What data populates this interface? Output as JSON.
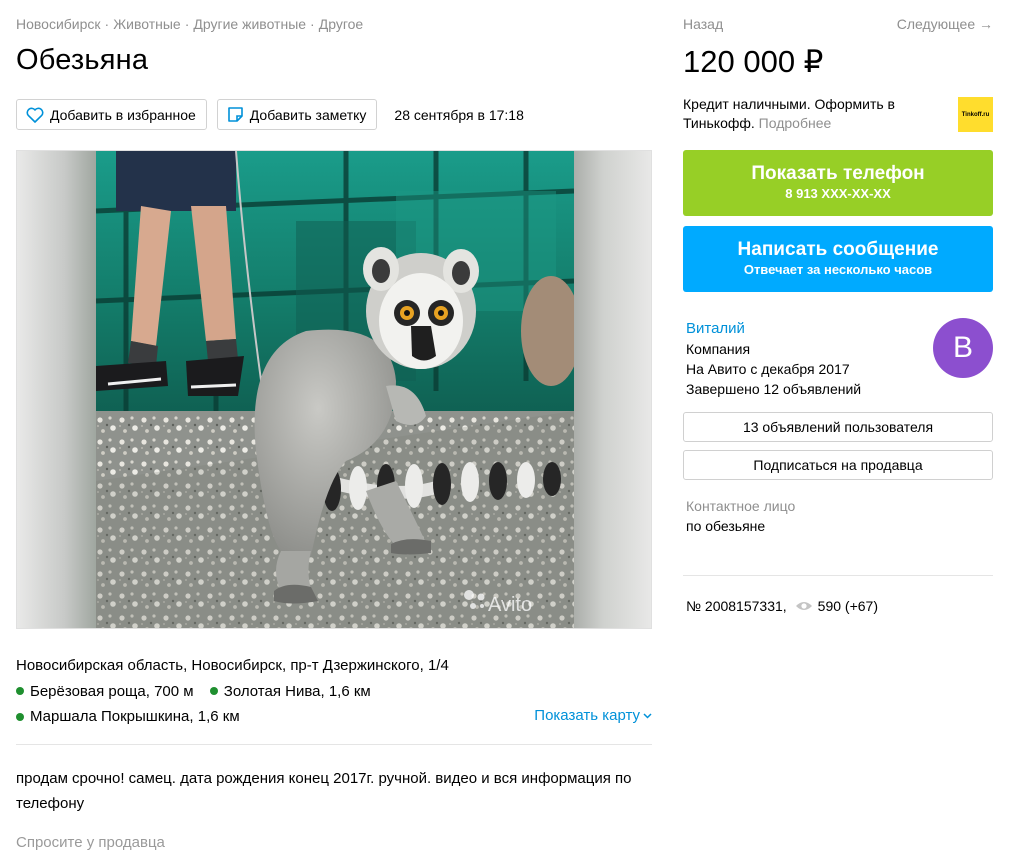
{
  "breadcrumbs": [
    "Новосибирск",
    "Животные",
    "Другие животные",
    "Другое"
  ],
  "breadcrumb_sep": "·",
  "title": "Обезьяна",
  "actions": {
    "favorite_label": "Добавить в избранное",
    "note_label": "Добавить заметку",
    "date": "28 сентября в 17:18"
  },
  "gallery": {
    "watermark": "Avito"
  },
  "location": {
    "address": "Новосибирская область, Новосибирск, пр-т Дзержинского, 1/4",
    "metro": [
      {
        "name": "Берёзовая роща",
        "distance": "700 м"
      },
      {
        "name": "Золотая Нива",
        "distance": "1,6 км"
      },
      {
        "name": "Маршала Покрышкина",
        "distance": "1,6 км"
      }
    ],
    "map_link": "Показать карту"
  },
  "description": "продам срочно! самец. дата рождения конец 2017г. ручной. видео и вся информация по телефону",
  "ask_seller": "Спросите у продавца",
  "nav": {
    "back": "Назад",
    "next": "Следующее →"
  },
  "price": "120 000 ₽",
  "credit": {
    "text": "Кредит наличными. Оформить в Тинькофф.",
    "more": "Подробнее",
    "logo": "Tinkoff.ru"
  },
  "phone_button": {
    "label": "Показать телефон",
    "number": "8 913 XXX-XX-XX"
  },
  "message_button": {
    "label": "Написать сообщение",
    "sub": "Отвечает за несколько часов"
  },
  "seller": {
    "name": "Виталий",
    "type": "Компания",
    "since": "На Авито с декабря 2017",
    "completed": "Завершено 12 объявлений",
    "avatar_letter": "B"
  },
  "seller_ads_button": "13 объявлений пользователя",
  "subscribe_button": "Подписаться на продавца",
  "contact": {
    "label": "Контактное лицо",
    "value": "по обезьяне"
  },
  "meta": {
    "ad_number": "№ 2008157331,",
    "views": "590 (+67)"
  },
  "colors": {
    "phone_button": "#97cf26",
    "message_button": "#00aaff",
    "link": "#0091d9",
    "avatar": "#8c4fcf",
    "metro_dot": "#1f8f2f"
  }
}
